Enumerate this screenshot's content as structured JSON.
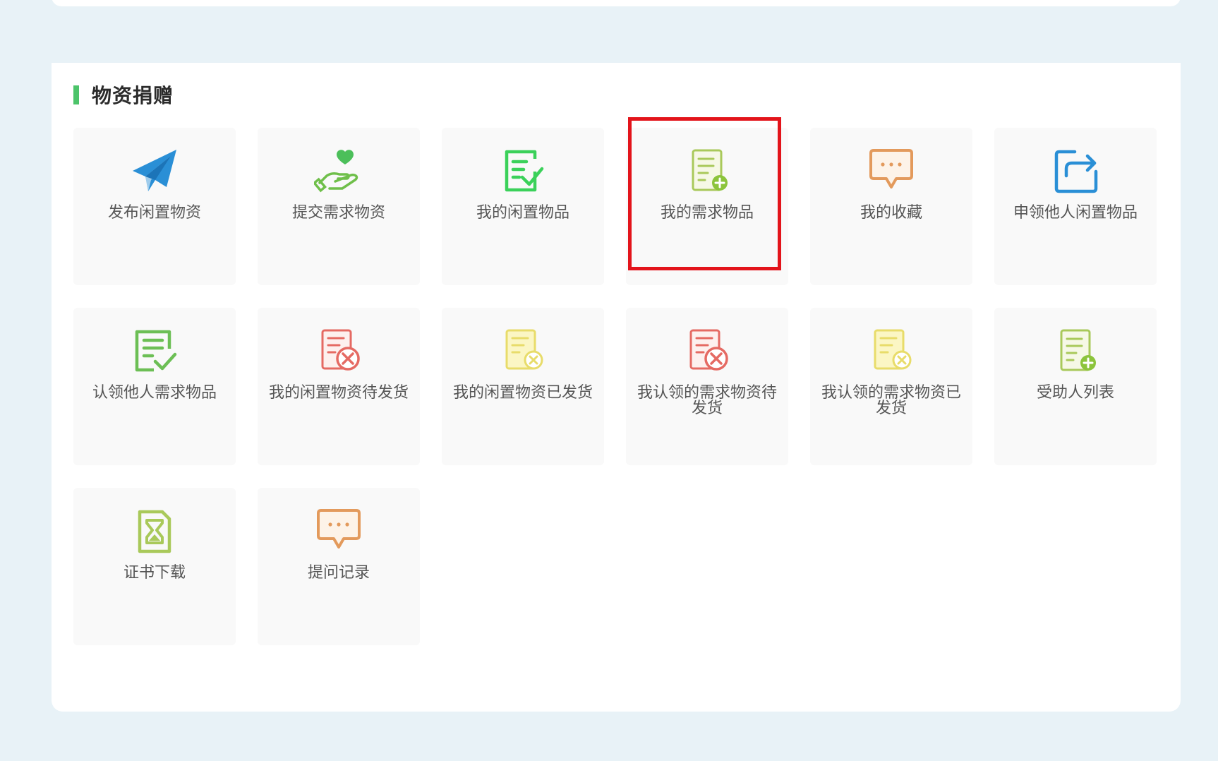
{
  "section": {
    "title": "物资捐赠"
  },
  "colors": {
    "accent_green": "#4cc46a",
    "highlight_red": "#e3141b"
  },
  "tiles": [
    {
      "label": "发布闲置物资",
      "icon": "paper-plane-icon"
    },
    {
      "label": "提交需求物资",
      "icon": "heart-hand-icon"
    },
    {
      "label": "我的闲置物品",
      "icon": "document-check-icon"
    },
    {
      "label": "我的需求物品",
      "icon": "document-add-icon"
    },
    {
      "label": "我的收藏",
      "icon": "chat-bubble-icon"
    },
    {
      "label": "申领他人闲置物品",
      "icon": "share-arrow-icon"
    },
    {
      "label": "认领他人需求物品",
      "icon": "document-check-icon"
    },
    {
      "label": "我的闲置物资待发货",
      "icon": "document-cancel-icon"
    },
    {
      "label": "我的闲置物资已发货",
      "icon": "document-cancel-icon"
    },
    {
      "label": "我认领的需求物资待发货",
      "icon": "document-cancel-icon"
    },
    {
      "label": "我认领的需求物资已发货",
      "icon": "document-cancel-icon"
    },
    {
      "label": "受助人列表",
      "icon": "document-add-icon"
    },
    {
      "label": "证书下载",
      "icon": "hourglass-file-icon"
    },
    {
      "label": "提问记录",
      "icon": "chat-bubble-icon"
    }
  ]
}
